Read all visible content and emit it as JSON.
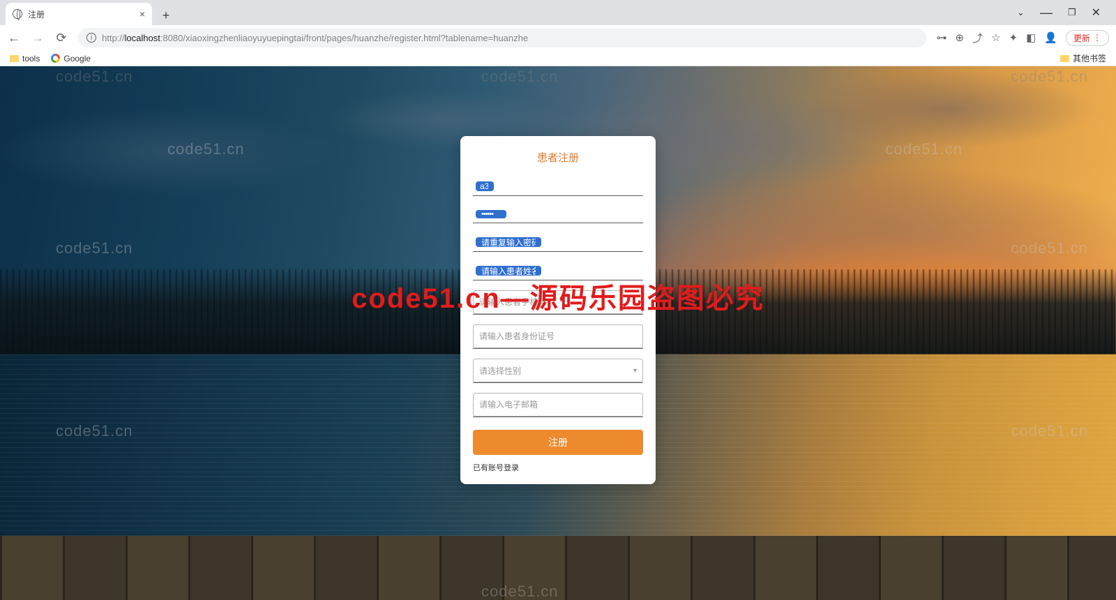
{
  "browser": {
    "tab_title": "注册",
    "url_host": "localhost",
    "url_port": ":8080",
    "url_path": "/xiaoxingzhenliaoyuyuepingtai/front/pages/huanzhe/register.html?tablename=huanzhe",
    "url_scheme": "http://",
    "update_label": "更新",
    "bookmarks": {
      "tools": "tools",
      "google": "Google",
      "other": "其他书签"
    }
  },
  "watermark": "code51.cn",
  "big_watermark": "code51.cn—源码乐园盗图必究",
  "form": {
    "title": "患者注册",
    "username_value": "a3",
    "password_value": "••••••",
    "confirm_placeholder": "请重复输入密码",
    "name_placeholder": "请输入患者姓名",
    "phone_placeholder": "请输入患者手机号",
    "idcard_placeholder": "请输入患者身份证号",
    "gender_placeholder": "请选择性别",
    "email_placeholder": "请输入电子邮箱",
    "submit_label": "注册",
    "login_link": "已有账号登录"
  }
}
